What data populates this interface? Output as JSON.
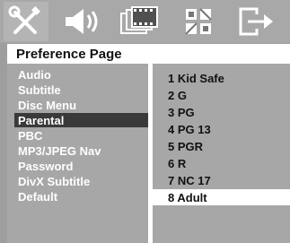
{
  "icons": [
    {
      "name": "tools-icon"
    },
    {
      "name": "speaker-icon"
    },
    {
      "name": "film-icon"
    },
    {
      "name": "pattern-icon"
    },
    {
      "name": "exit-icon"
    }
  ],
  "page_title": "Preference Page",
  "menu": {
    "items": [
      {
        "label": "Audio"
      },
      {
        "label": "Subtitle"
      },
      {
        "label": "Disc Menu"
      },
      {
        "label": "Parental"
      },
      {
        "label": "PBC"
      },
      {
        "label": "MP3/JPEG Nav"
      },
      {
        "label": "Password"
      },
      {
        "label": "DivX Subtitle"
      },
      {
        "label": "Default"
      }
    ],
    "selected": "Parental"
  },
  "options": {
    "items": [
      {
        "label": "1 Kid Safe"
      },
      {
        "label": "2 G"
      },
      {
        "label": "3 PG"
      },
      {
        "label": "4 PG 13"
      },
      {
        "label": "5 PGR"
      },
      {
        "label": "6 R"
      },
      {
        "label": "7 NC 17"
      },
      {
        "label": "8 Adult"
      }
    ],
    "highlighted": "8 Adult"
  },
  "colors": {
    "screen_bg": "#9e9e9e",
    "panel_bg": "#a7a7a7",
    "selected_bg": "#3a3a3a",
    "highlight_bg": "#ffffff"
  }
}
